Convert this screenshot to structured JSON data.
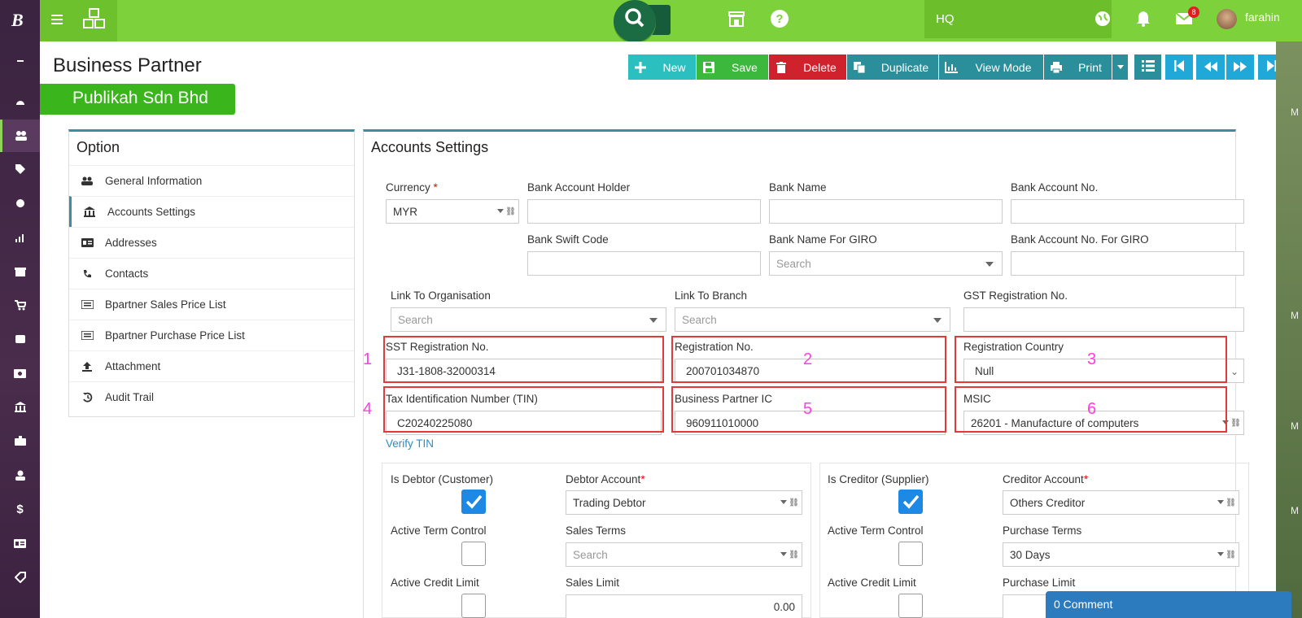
{
  "app": {
    "logo": "B",
    "location": "HQ",
    "user": "farahin",
    "notifications": "8"
  },
  "page": {
    "title": "Business Partner",
    "company": "Publikah Sdn Bhd"
  },
  "toolbar": {
    "new": "New",
    "save": "Save",
    "delete": "Delete",
    "duplicate": "Duplicate",
    "view_mode": "View Mode",
    "print": "Print"
  },
  "option": {
    "title": "Option",
    "items": [
      "General Information",
      "Accounts Settings",
      "Addresses",
      "Contacts",
      "Bpartner Sales Price List",
      "Bpartner Purchase Price List",
      "Attachment",
      "Audit Trail"
    ]
  },
  "accounts": {
    "title": "Accounts Settings",
    "currency_label": "Currency",
    "currency": "MYR",
    "bank_holder_label": "Bank Account Holder",
    "bank_name_label": "Bank Name",
    "bank_no_label": "Bank Account No.",
    "swift_label": "Bank Swift Code",
    "giro_name_label": "Bank Name For GIRO",
    "giro_name_ph": "Search",
    "giro_no_label": "Bank Account No. For GIRO",
    "link_org_label": "Link To Organisation",
    "link_org_ph": "Search",
    "link_branch_label": "Link To Branch",
    "link_branch_ph": "Search",
    "gst_label": "GST Registration No.",
    "sst_label": "SST Registration No.",
    "sst": "J31-1808-32000314",
    "reg_label": "Registration No.",
    "reg": "200701034870",
    "country_label": "Registration Country",
    "country": "Null",
    "tin_label": "Tax Identification Number (TIN)",
    "tin": "C20240225080",
    "ic_label": "Business Partner IC",
    "ic": "960911010000",
    "msic_label": "MSIC",
    "msic": "26201 - Manufacture of computers",
    "verify": "Verify TIN",
    "nums": [
      "1",
      "2",
      "3",
      "4",
      "5",
      "6"
    ]
  },
  "debtor": {
    "is_label": "Is Debtor (Customer)",
    "account_label": "Debtor Account",
    "account": "Trading Debtor",
    "term_label": "Active Term Control",
    "terms_label": "Sales Terms",
    "terms_ph": "Search",
    "credit_label": "Active Credit Limit",
    "limit_label": "Sales Limit",
    "limit": "0.00"
  },
  "creditor": {
    "is_label": "Is Creditor (Supplier)",
    "account_label": "Creditor Account",
    "account": "Others Creditor",
    "term_label": "Active Term Control",
    "terms_label": "Purchase Terms",
    "terms": "30 Days",
    "credit_label": "Active Credit Limit",
    "limit_label": "Purchase Limit"
  },
  "comment": "0 Comment",
  "side_letters": [
    "M",
    "M",
    "M",
    "M"
  ],
  "colors": {
    "topbar": "#7dd13a",
    "accent": "#3b8e9c",
    "new": "#2bbfbf",
    "save": "#3cb83c",
    "delete": "#d0222d",
    "teal": "#2a8f9a",
    "nav": "#20a8d8",
    "highlight": "#e23a3a",
    "number": "#ff3de0"
  }
}
